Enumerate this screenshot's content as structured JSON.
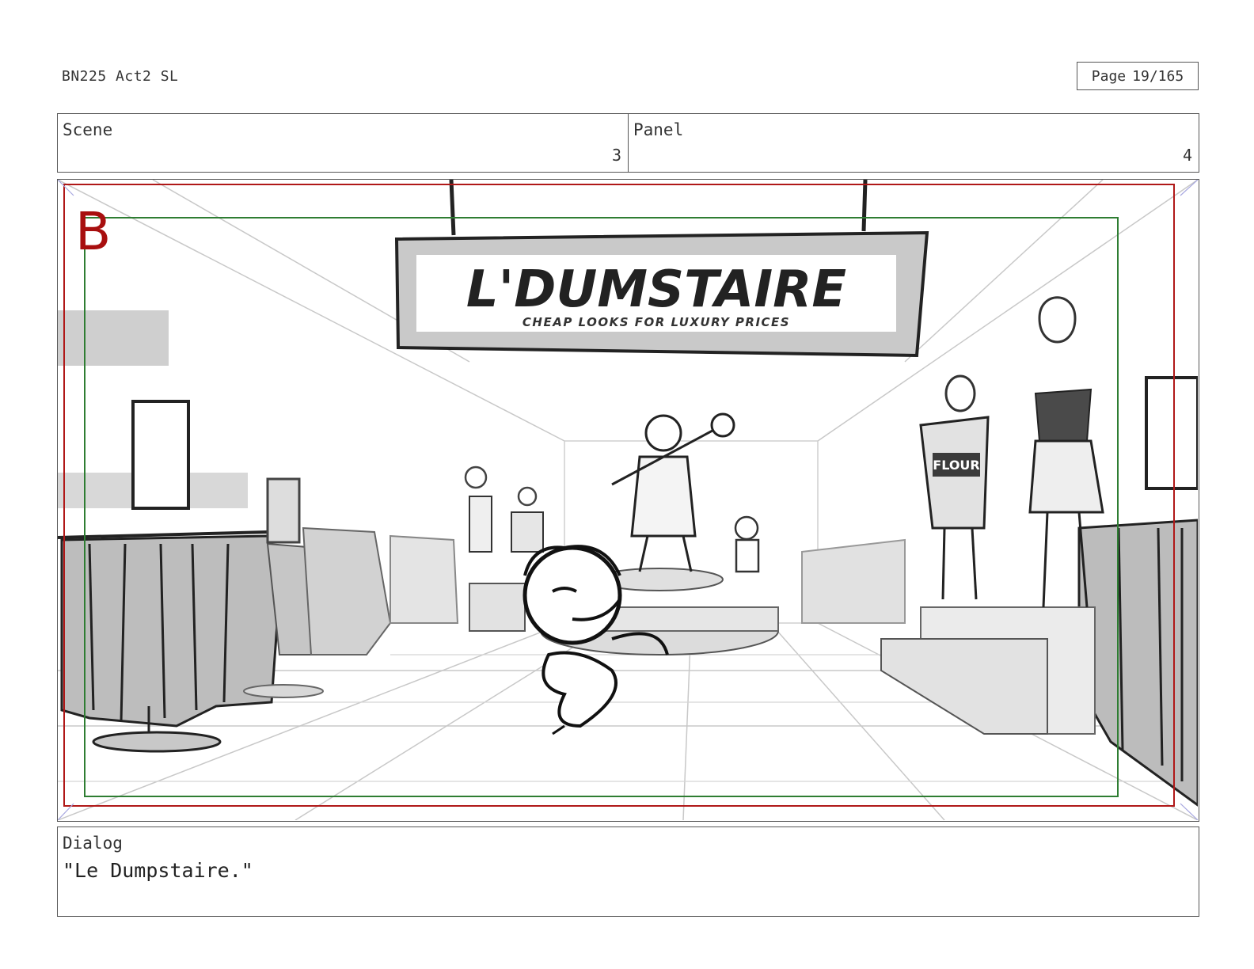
{
  "document": {
    "title": "BN225 Act2 SL",
    "page_label": "Page",
    "page_number": "19/165"
  },
  "scene": {
    "label": "Scene",
    "value": "3"
  },
  "panel": {
    "label": "Panel",
    "value": "4",
    "marker": "B"
  },
  "artwork": {
    "sign_title": "L'DUMSTAIRE",
    "sign_tagline": "CHEAP LOOKS FOR LUXURY PRICES",
    "shirt_text": "FLOUR",
    "colors": {
      "safe_frame_red": "#b01818",
      "safe_frame_green": "#2e7d32",
      "marker": "#a80f0f"
    }
  },
  "dialog": {
    "label": "Dialog",
    "text": "\"Le Dumpstaire.\""
  }
}
